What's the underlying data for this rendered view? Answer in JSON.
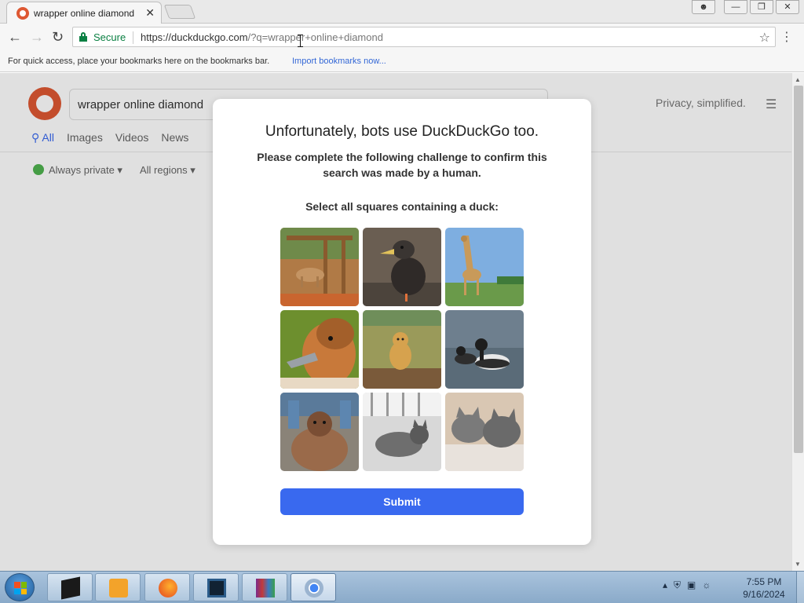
{
  "browser": {
    "tab_title": "wrapper online diamond",
    "tab_close": "✕",
    "secure_label": "Secure",
    "url_host": "https://duckduckgo.com",
    "url_rest": "/?q=wrapper+online+diamond",
    "bookmarks_hint": "For quick access, place your bookmarks here on the bookmarks bar.",
    "bookmarks_import": "Import bookmarks now..."
  },
  "ddg_page": {
    "search_query": "wrapper online diamond",
    "privacy_tagline": "Privacy, simplified.",
    "tabs": [
      "All",
      "Images",
      "Videos",
      "News"
    ],
    "filter_private": "Always private ▾",
    "filter_region": "All regions ▾"
  },
  "captcha": {
    "heading": "Unfortunately, bots use DuckDuckGo too.",
    "subheading": "Please complete the following challenge to confirm this search was made by a human.",
    "prompt": "Select all squares containing a duck:",
    "submit_label": "Submit",
    "tiles": [
      "horse-in-stable",
      "duck-standing",
      "giraffe",
      "duck-head-closeup",
      "lion-cub",
      "ducks-swimming",
      "orangutan",
      "cat-grayscale",
      "two-cats"
    ]
  },
  "taskbar": {
    "clock_time": "7:55 PM",
    "clock_date": "9/16/2024"
  },
  "colors": {
    "accent": "#3969ef",
    "ddg_orange": "#de5833",
    "secure_green": "#0b8043"
  }
}
